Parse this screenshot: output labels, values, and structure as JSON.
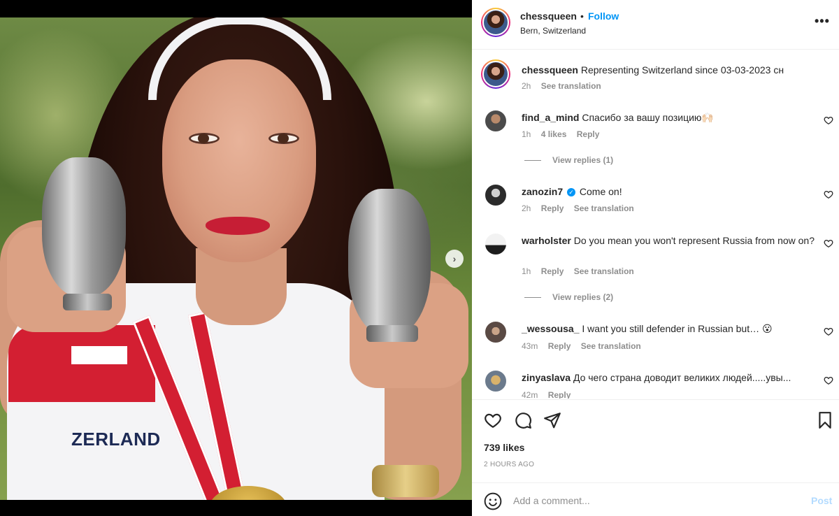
{
  "post": {
    "username": "chessqueen",
    "follow_label": "Follow",
    "separator": "•",
    "location": "Bern, Switzerland",
    "more_label": "•••",
    "image_text": "ZERLAND"
  },
  "caption": {
    "username": "chessqueen",
    "text": "Representing Switzerland since 03-03-2023 сн",
    "time": "2h",
    "see_translation": "See translation"
  },
  "comments": [
    {
      "username": "find_a_mind",
      "text": "Спасибо за вашу позицию🙌🏻",
      "time": "1h",
      "likes": "4 likes",
      "reply": "Reply",
      "see_translation": "",
      "view_replies": "View replies (1)"
    },
    {
      "username": "zanozin7",
      "verified": "✓",
      "text": "Come on!",
      "time": "2h",
      "reply": "Reply",
      "see_translation": "See translation"
    },
    {
      "username": "warholster",
      "text": "Do you mean you won't represent Russia from now on?",
      "time": "1h",
      "reply": "Reply",
      "see_translation": "See translation",
      "view_replies": "View replies (2)"
    },
    {
      "username": "_wessousa_",
      "text": "I want you still defender in Russian but… 😮",
      "time": "43m",
      "reply": "Reply",
      "see_translation": "See translation"
    },
    {
      "username": "zinyaslava",
      "text": "До чего страна доводит великих людей.....увы...",
      "time": "42m",
      "reply": "Reply"
    }
  ],
  "actions": {
    "likes": "739 likes",
    "time_ago": "2 HOURS AGO"
  },
  "composer": {
    "placeholder": "Add a comment...",
    "post_label": "Post"
  },
  "colors": {
    "accent": "#0095f6",
    "muted": "#8e8e8e",
    "text": "#262626",
    "post_disabled": "#b3dbff"
  }
}
